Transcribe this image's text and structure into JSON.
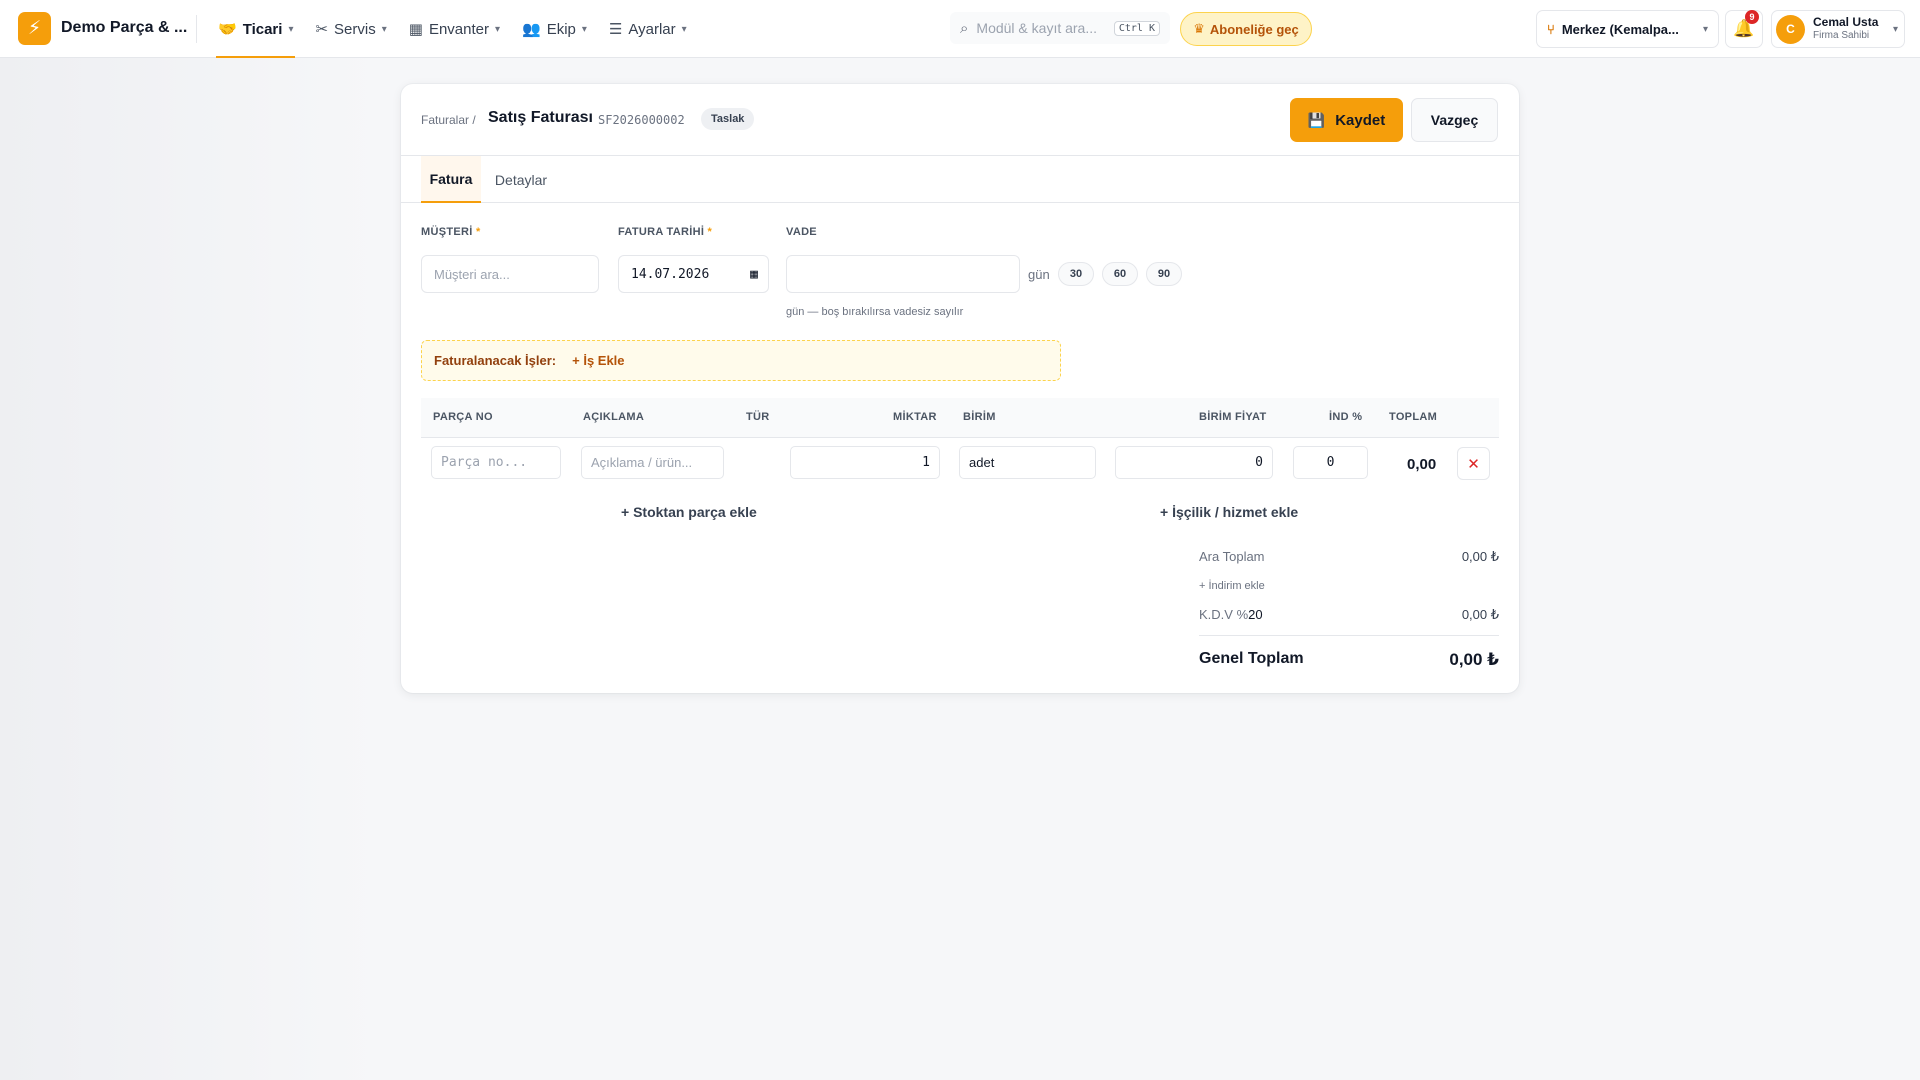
{
  "app": {
    "brand": "Demo Parça & ...",
    "nav": [
      {
        "label": "Ticari",
        "icon": "handshake-icon",
        "active": true
      },
      {
        "label": "Servis",
        "icon": "tools-icon"
      },
      {
        "label": "Envanter",
        "icon": "boxes-icon"
      },
      {
        "label": "Ekip",
        "icon": "users-icon"
      },
      {
        "label": "Ayarlar",
        "icon": "sliders-icon"
      }
    ],
    "search": {
      "placeholder": "Modül & kayıt ara...",
      "shortcut": "Ctrl K"
    },
    "subscribe_label": "Aboneliğe geç",
    "branch_label": "Merkez (Kemalpa...",
    "notifications_count": "9",
    "user": {
      "initial": "C",
      "name": "Cemal Usta",
      "role": "Firma Sahibi"
    },
    "accent_color": "#f59e0b"
  },
  "invoice": {
    "breadcrumb": "Faturalar /",
    "title": "Satış Faturası",
    "number": "SF2026000002",
    "status": "Taslak",
    "save_label": "Kaydet",
    "cancel_label": "Vazgeç",
    "tabs": [
      {
        "label": "Fatura",
        "active": true
      },
      {
        "label": "Detaylar"
      }
    ],
    "form": {
      "customer_label": "MÜŞTERİ",
      "customer_placeholder": "Müşteri ara...",
      "date_label": "FATURA TARİHİ",
      "date_value": "14.07.2026",
      "due_label": "VADE",
      "due_value": "",
      "due_unit": "gün",
      "due_chips": [
        "30",
        "60",
        "90"
      ],
      "due_hint": "gün — boş bırakılırsa vadesiz sayılır",
      "required_mark": "*"
    },
    "jobs": {
      "label": "Faturalanacak İşler:",
      "add_label": "+ İş Ekle"
    },
    "table": {
      "headers": [
        "PARÇA NO",
        "AÇIKLAMA",
        "TÜR",
        "MİKTAR",
        "BİRİM",
        "BİRİM FİYAT",
        "İND %",
        "TOPLAM"
      ],
      "row": {
        "part_placeholder": "Parça no...",
        "desc_placeholder": "Açıklama / ürün...",
        "quantity": "1",
        "unit": "adet",
        "unit_price": "0",
        "discount": "0",
        "total": "0,00"
      },
      "add_stock_label": "+ Stoktan parça ekle",
      "add_labor_label": "+ İşçilik / hizmet ekle"
    },
    "summary": {
      "subtotal_label": "Ara Toplam",
      "subtotal_value": "0,00 ₺",
      "add_discount_label": "+ İndirim ekle",
      "vat_label": "K.D.V %",
      "vat_rate": "20",
      "vat_value": "0,00 ₺",
      "grand_label": "Genel Toplam",
      "grand_value": "0,00 ₺"
    }
  }
}
